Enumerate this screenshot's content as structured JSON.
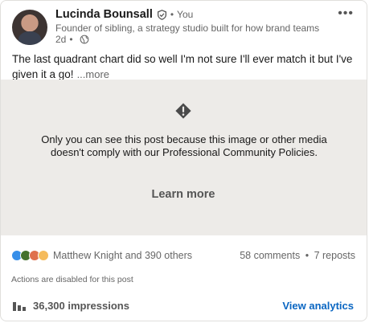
{
  "author": {
    "name": "Lucinda Bounsall",
    "relation_separator": "•",
    "relation": "You",
    "headline": "Founder of sibling, a strategy studio built for how brand teams (...",
    "time": "2d",
    "time_separator": "•"
  },
  "post": {
    "text": "The last quadrant chart did so well I'm not sure I'll ever match it but I've given it a go!",
    "see_more": "...more"
  },
  "blocked_media": {
    "message": "Only you can see this post because this image or other media doesn't comply with our Professional Community Policies.",
    "learn_more": "Learn more"
  },
  "social": {
    "reacters": "Matthew Knight and 390 others",
    "comments": "58 comments",
    "separator": "•",
    "reposts": "7 reposts"
  },
  "actions_note": "Actions are disabled for this post",
  "analytics": {
    "impressions": "36,300 impressions",
    "view_analytics": "View analytics"
  },
  "colors": {
    "link_blue": "#0a66c2",
    "blocked_bg": "#edebe8",
    "like_blue": "#378fe9",
    "celebrate_green": "#44712e",
    "love_red": "#df704d",
    "insight_yellow": "#f5bb5c"
  },
  "icons": [
    "verified-shield-icon",
    "globe-icon",
    "more-options-icon",
    "warning-icon",
    "like-reaction-icon",
    "celebrate-reaction-icon",
    "love-reaction-icon",
    "insight-reaction-icon",
    "bar-chart-icon"
  ]
}
